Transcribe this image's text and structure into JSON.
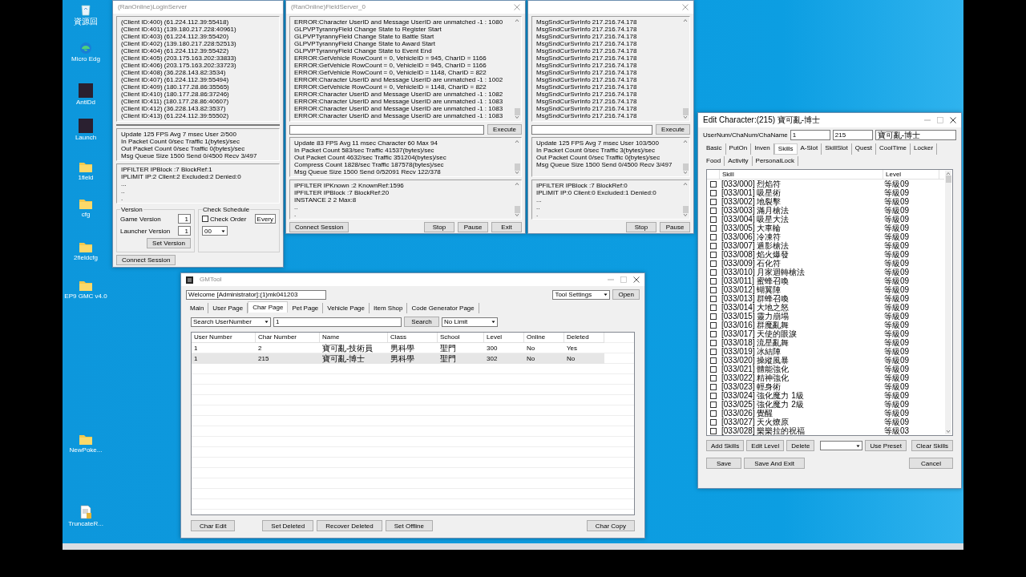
{
  "desktop_icons": [
    {
      "kind": "recycle",
      "label": "資源回"
    },
    {
      "kind": "browser",
      "label": "Micro Edg"
    },
    {
      "kind": "app",
      "label": "AntiDd"
    },
    {
      "kind": "app",
      "label": "Launch"
    },
    {
      "kind": "folder",
      "label": "1field"
    },
    {
      "kind": "folder",
      "label": "cfg"
    },
    {
      "kind": "folder",
      "label": "2fieldcfg"
    },
    {
      "kind": "folder",
      "label": "EP9 GMC v4.0"
    },
    {
      "kind": "folder",
      "label": "NewPoke..."
    },
    {
      "kind": "file",
      "label": "TruncateR..."
    }
  ],
  "login_server": {
    "title": "(RanOnline)LoginServer",
    "log_lines": [
      "(Client ID:400) (61.224.112.39:55418)",
      "(Client ID:401) (139.180.217.228:40961)",
      "(Client ID:403) (61.224.112.39:55420)",
      "(Client ID:402) (139.180.217.228:52513)",
      "(Client ID:404) (61.224.112.39:55422)",
      "(Client ID:405) (203.175.163.202:33833)",
      "(Client ID:406) (203.175.163.202:33723)",
      "(Client ID:408) (36.228.143.82:3534)",
      "(Client ID:407) (61.224.112.39:55494)",
      "(Client ID:409) (180.177.28.86:35565)",
      "(Client ID:410) (180.177.28.86:37246)",
      "(Client ID:411) (180.177.28.86:40607)",
      "(Client ID:412) (36.228.143.82:3537)",
      "(Client ID:413) (61.224.112.39:55502)"
    ],
    "stats_lines": [
      "Update 125 FPS Avg 7 msec User 2/500",
      "In Packet Count 0/sec Traffic 1(bytes)/sec",
      "Out Packet Count 0/sec Traffic 0(bytes)/sec",
      "Msg Queue Size 1500 Send 0/4500 Recv 3/497"
    ],
    "filter_lines": [
      "IPFILTER IPBlock :7 BlockRef:1",
      "IPLIMIT IP:2 Client:2 Excluded:2 Denied:0",
      "...",
      "..",
      "."
    ],
    "version": {
      "label": "Version",
      "game_version_label": "Game Version",
      "game_version": "1",
      "launcher_version_label": "Launcher Version",
      "launcher_version": "1",
      "set_button": "Set Version"
    },
    "check_schedule": {
      "label": "Check Schedule",
      "check_order": {
        "label": "Check Order",
        "checked": false
      },
      "hour": "00",
      "every": "Every"
    },
    "connect_button": "Connect Session"
  },
  "field_server": {
    "title": "(RanOnline)FieldServer_0",
    "log_lines": [
      "ERROR:Character UserID and Message UserID are unmatched -1 : 1080",
      "GLPVPTyrannyField Change State to Register Start",
      "GLPVPTyrannyField Change State to Battle Start",
      "GLPVPTyrannyField Change State to Award Start",
      "GLPVPTyrannyField Change State to Event End",
      "ERROR:GetVehicle RowCount = 0, VehicleID = 945, CharID = 1166",
      "ERROR:GetVehicle RowCount = 0, VehicleID = 945, CharID = 1166",
      "ERROR:GetVehicle RowCount = 0, VehicleID = 1148, CharID = 822",
      "ERROR:Character UserID and Message UserID are unmatched -1 : 1002",
      "ERROR:GetVehicle RowCount = 0, VehicleID = 1148, CharID = 822",
      "ERROR:Character UserID and Message UserID are unmatched -1 : 1082",
      "ERROR:Character UserID and Message UserID are unmatched -1 : 1083",
      "ERROR:Character UserID and Message UserID are unmatched -1 : 1083",
      "ERROR:Character UserID and Message UserID are unmatched -1 : 1083"
    ],
    "execute_button": "Execute",
    "stats_lines": [
      "Update 83 FPS Avg 11 msec Character 60 Max 94",
      "In Packet Count 583/sec Traffic 41537(bytes)/sec",
      "Out Packet Count 4632/sec Traffic 351204(bytes)/sec",
      "Compress Count 1828/sec Traffic 187578(bytes)/sec",
      "Msg Queue Size 1500 Send 0/52091 Recv 122/378"
    ],
    "filter_lines": [
      "IPFILTER IPKnown :2 KnownRef:1596",
      "IPFILTER IPBlock :7 BlockRef:20",
      "INSTANCE 2 2 Max:8",
      "..",
      "."
    ],
    "connect_button": "Connect Session",
    "buttons": [
      "Stop",
      "Pause",
      "Exit"
    ]
  },
  "msg_server": {
    "log_lines": [
      "MsgSndCurSvrInfo 217.216.74.178",
      "MsgSndCurSvrInfo 217.216.74.178",
      "MsgSndCurSvrInfo 217.216.74.178",
      "MsgSndCurSvrInfo 217.216.74.178",
      "MsgSndCurSvrInfo 217.216.74.178",
      "MsgSndCurSvrInfo 217.216.74.178",
      "MsgSndCurSvrInfo 217.216.74.178",
      "MsgSndCurSvrInfo 217.216.74.178",
      "MsgSndCurSvrInfo 217.216.74.178",
      "MsgSndCurSvrInfo 217.216.74.178",
      "MsgSndCurSvrInfo 217.216.74.178",
      "MsgSndCurSvrInfo 217.216.74.178",
      "MsgSndCurSvrInfo 217.216.74.178",
      "MsgSndCurSvrInfo 217.216.74.178"
    ],
    "execute_button": "Execute",
    "stats_lines": [
      "Update 125 FPS Avg 7 msec User 103/500",
      "In Packet Count 0/sec Traffic 3(bytes)/sec",
      "Out Packet Count 0/sec Traffic 0(bytes)/sec",
      "Msg Queue Size 1500 Send 0/4500 Recv 3/497"
    ],
    "filter_lines": [
      "IPFILTER IPBlock :7 BlockRef:0",
      "IPLIMIT IP:0 Client:0 Excluded:1 Denied:0",
      "...",
      "..",
      "."
    ],
    "buttons": [
      "Stop",
      "Pause"
    ]
  },
  "gm_tool": {
    "title": "GMTool",
    "welcome": "Welcome [Administrator]:(1)mk041203",
    "tool_settings": "Tool Settings",
    "open_button": "Open",
    "tabs": [
      {
        "label": "Main",
        "selected": false
      },
      {
        "label": "User Page",
        "selected": false
      },
      {
        "label": "Char Page",
        "selected": true
      },
      {
        "label": "Pet Page",
        "selected": false
      },
      {
        "label": "Vehicle Page",
        "selected": false
      },
      {
        "label": "Item Shop",
        "selected": false
      },
      {
        "label": "Code Generator Page",
        "selected": false
      }
    ],
    "search_type": "Search UserNumber",
    "search_value": "1",
    "search_button": "Search",
    "limit": "No Limit",
    "columns": [
      "User Number",
      "Char Number",
      "Name",
      "Class",
      "School",
      "Level",
      "Online",
      "Deleted"
    ],
    "rows": [
      {
        "cells": [
          "1",
          "2",
          "寶可亂-技術員",
          "男科學",
          "聖門",
          "300",
          "No",
          "Yes"
        ],
        "selected": false
      },
      {
        "cells": [
          "1",
          "215",
          "寶可亂-博士",
          "男科學",
          "聖門",
          "302",
          "No",
          "No"
        ],
        "selected": true
      }
    ],
    "buttons": [
      "Char Edit",
      "Set Deleted",
      "Recover Deleted",
      "Set Offline"
    ],
    "copy_button": "Char Copy"
  },
  "edit_character": {
    "title": "Edit Character:(215) 寶可亂-博士",
    "id_label": "UserNum/ChaNum/ChaName",
    "user_num": "1",
    "cha_num": "215",
    "cha_name": "寶可亂-博士",
    "tabs": [
      {
        "label": "Basic",
        "selected": false
      },
      {
        "label": "PutOn",
        "selected": false
      },
      {
        "label": "Inven",
        "selected": false
      },
      {
        "label": "Skills",
        "selected": true
      },
      {
        "label": "A-Slot",
        "selected": false
      },
      {
        "label": "SkillSlot",
        "selected": false
      },
      {
        "label": "Quest",
        "selected": false
      },
      {
        "label": "CoolTime",
        "selected": false
      },
      {
        "label": "Locker",
        "selected": false
      },
      {
        "label": "Food",
        "selected": false
      },
      {
        "label": "Activity",
        "selected": false
      },
      {
        "label": "PersonalLock",
        "selected": false
      }
    ],
    "columns": [
      "Skill",
      "Level"
    ],
    "skills": [
      {
        "name": "[033/000] 烈焰符",
        "level": "等級09",
        "checked": false
      },
      {
        "name": "[033/001] 吸星術",
        "level": "等級09",
        "checked": false
      },
      {
        "name": "[033/002] 地裂擊",
        "level": "等級09",
        "checked": false
      },
      {
        "name": "[033/003] 滿月槍法",
        "level": "等級09",
        "checked": false
      },
      {
        "name": "[033/004] 吸星大法",
        "level": "等級09",
        "checked": false
      },
      {
        "name": "[033/005] 大車輪",
        "level": "等級09",
        "checked": false
      },
      {
        "name": "[033/006] 冷凍符",
        "level": "等級09",
        "checked": false
      },
      {
        "name": "[033/007] 遁影槍法",
        "level": "等級09",
        "checked": false
      },
      {
        "name": "[033/008] 焰火爆發",
        "level": "等級09",
        "checked": false
      },
      {
        "name": "[033/009] 石化符",
        "level": "等級09",
        "checked": false
      },
      {
        "name": "[033/010] 月家迴轉槍法",
        "level": "等級09",
        "checked": false
      },
      {
        "name": "[033/011] 蜜蜂召喚",
        "level": "等級09",
        "checked": false
      },
      {
        "name": "[033/012] 蝴翼陣",
        "level": "等級09",
        "checked": false
      },
      {
        "name": "[033/013] 群蜂召喚",
        "level": "等級09",
        "checked": false
      },
      {
        "name": "[033/014] 大地之怒",
        "level": "等級09",
        "checked": false
      },
      {
        "name": "[033/015] 靈力崩塌",
        "level": "等級09",
        "checked": false
      },
      {
        "name": "[033/016] 群魔亂舞",
        "level": "等級09",
        "checked": false
      },
      {
        "name": "[033/017] 天使的眼淚",
        "level": "等級09",
        "checked": false
      },
      {
        "name": "[033/018] 流星亂舞",
        "level": "等級09",
        "checked": false
      },
      {
        "name": "[033/019] 冰結陣",
        "level": "等級09",
        "checked": false
      },
      {
        "name": "[033/020] 操縱風暴",
        "level": "等級09",
        "checked": false
      },
      {
        "name": "[033/021] 體能強化",
        "level": "等級09",
        "checked": false
      },
      {
        "name": "[033/022] 精神強化",
        "level": "等級09",
        "checked": false
      },
      {
        "name": "[033/023] 輕身術",
        "level": "等級09",
        "checked": false
      },
      {
        "name": "[033/024] 強化魔力 1級",
        "level": "等級09",
        "checked": false
      },
      {
        "name": "[033/025] 強化魔力 2級",
        "level": "等級09",
        "checked": false
      },
      {
        "name": "[033/026] 覺醒",
        "level": "等級09",
        "checked": false
      },
      {
        "name": "[033/027] 天火燎原",
        "level": "等級09",
        "checked": false
      },
      {
        "name": "[033/028] 樂樂拉的祝福",
        "level": "等級03",
        "checked": false
      }
    ],
    "list_buttons": [
      "Add Skills",
      "Edit Level",
      "Delete"
    ],
    "use_preset_button": "Use Preset",
    "clear_skills_button": "Clear Skills",
    "footer_buttons": [
      "Save",
      "Save And Exit"
    ],
    "cancel_button": "Cancel"
  }
}
